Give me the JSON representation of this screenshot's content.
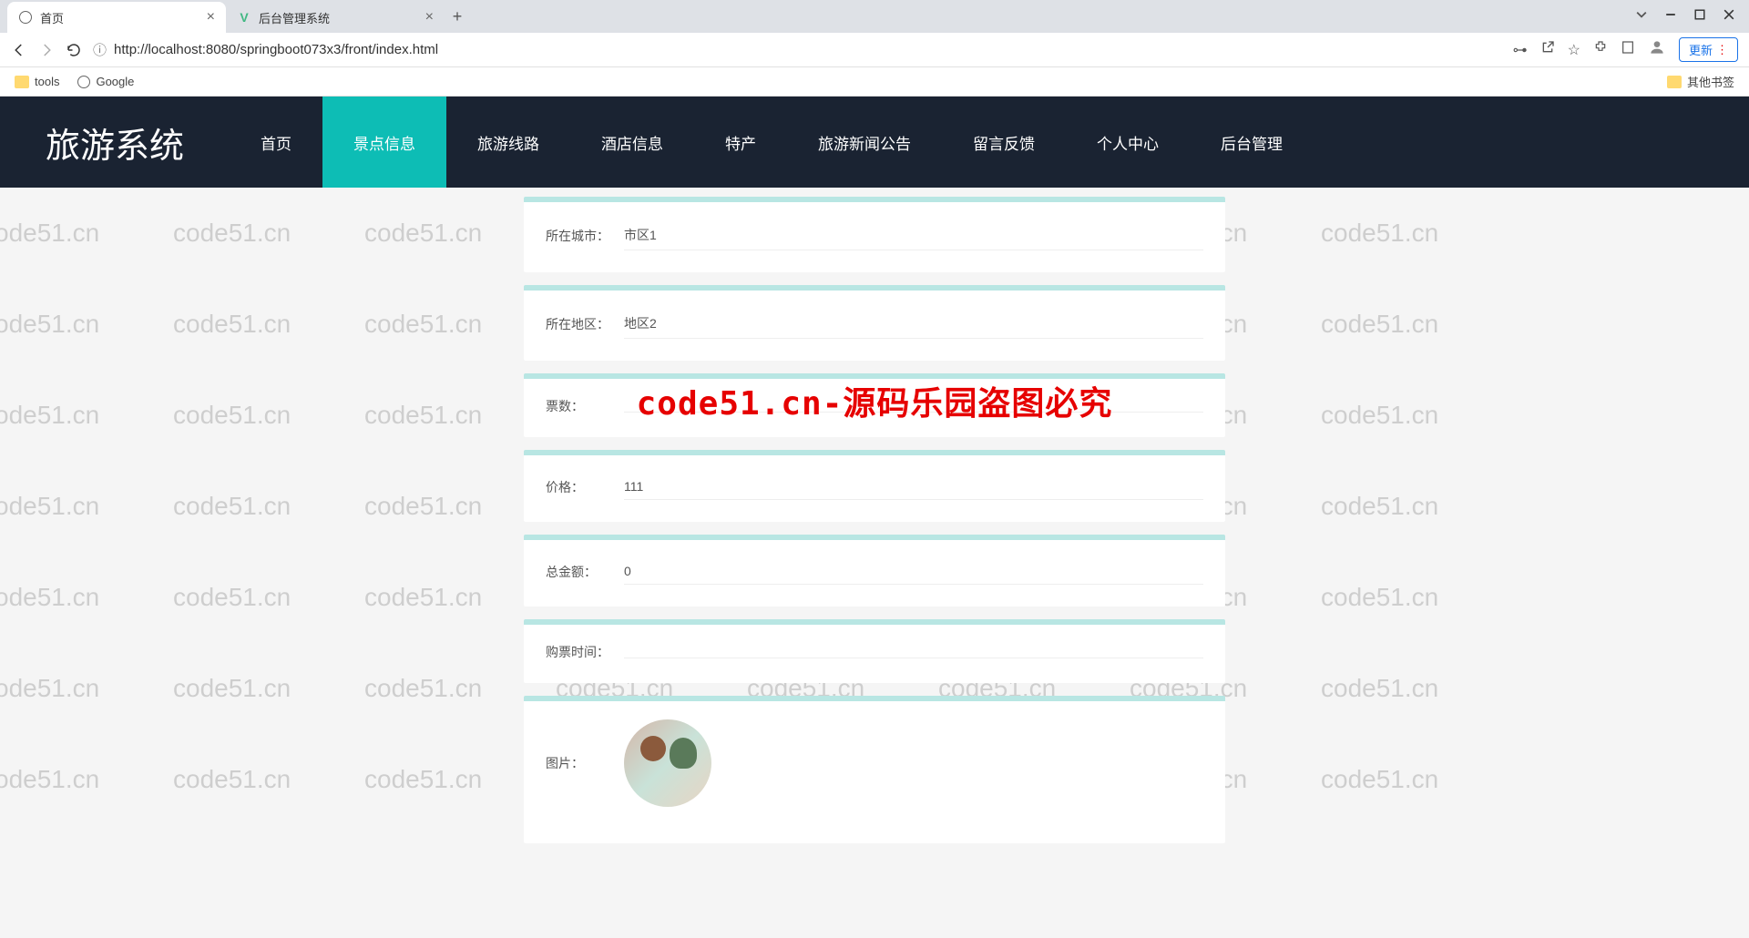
{
  "browser": {
    "tabs": [
      {
        "title": "首页",
        "icon": "globe"
      },
      {
        "title": "后台管理系统",
        "icon": "vue"
      }
    ],
    "url": "http://localhost:8080/springboot073x3/front/index.html",
    "update_label": "更新",
    "bookmarks": {
      "tools": "tools",
      "google": "Google",
      "other": "其他书签"
    }
  },
  "site": {
    "logo": "旅游系统",
    "nav": [
      "首页",
      "景点信息",
      "旅游线路",
      "酒店信息",
      "特产",
      "旅游新闻公告",
      "留言反馈",
      "个人中心",
      "后台管理"
    ]
  },
  "form": {
    "fields": [
      {
        "label": "所在城市：",
        "value": "市区1"
      },
      {
        "label": "所在地区：",
        "value": "地区2"
      },
      {
        "label": "票数：",
        "value": ""
      },
      {
        "label": "价格：",
        "value": "111"
      },
      {
        "label": "总金额：",
        "value": "0"
      },
      {
        "label": "购票时间：",
        "value": ""
      }
    ],
    "image_label": "图片："
  },
  "watermark": {
    "repeat": "code51.cn",
    "center": "code51.cn-源码乐园盗图必究"
  }
}
